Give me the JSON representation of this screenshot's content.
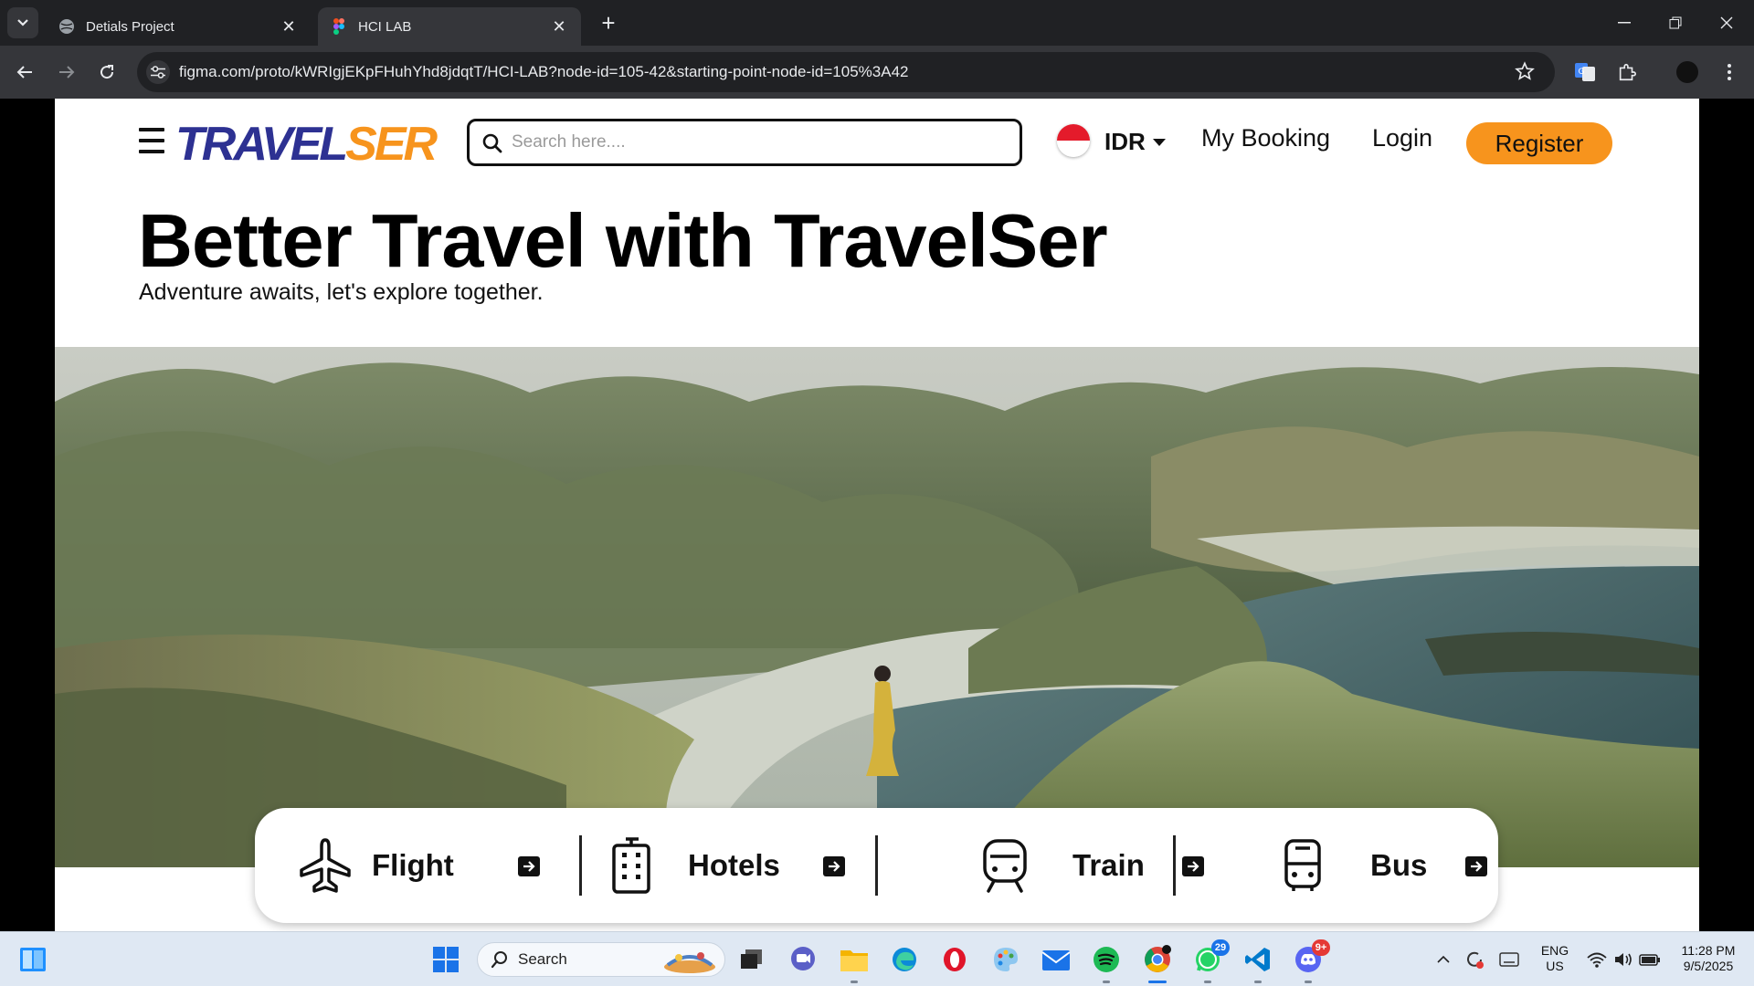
{
  "browser": {
    "tabs": [
      {
        "title": "Detials Project",
        "active": false
      },
      {
        "title": "HCI LAB",
        "active": true
      }
    ],
    "url": "figma.com/proto/kWRIgjEKpFHuhYhd8jdqtT/HCI-LAB?node-id=105-42&starting-point-node-id=105%3A42"
  },
  "site": {
    "logo_part1": "TRAVEL",
    "logo_part2": "SER",
    "search_placeholder": "Search here....",
    "currency": "IDR",
    "nav": {
      "my_booking": "My Booking",
      "login": "Login",
      "register": "Register"
    },
    "hero_title": "Better Travel with TravelSer",
    "hero_subtitle": "Adventure awaits, let's explore together.",
    "services": [
      {
        "label": "Flight",
        "icon": "airplane-icon"
      },
      {
        "label": "Hotels",
        "icon": "hotel-building-icon"
      },
      {
        "label": "Train",
        "icon": "train-icon"
      },
      {
        "label": "Bus",
        "icon": "bus-icon"
      }
    ],
    "colors": {
      "brand_blue": "#2d3192",
      "brand_orange": "#f7941d"
    }
  },
  "taskbar": {
    "search_label": "Search",
    "whatsapp_badge": "29",
    "discord_badge": "9+",
    "language": "ENG",
    "region": "US",
    "time": "11:28 PM",
    "date": "9/5/2025"
  }
}
